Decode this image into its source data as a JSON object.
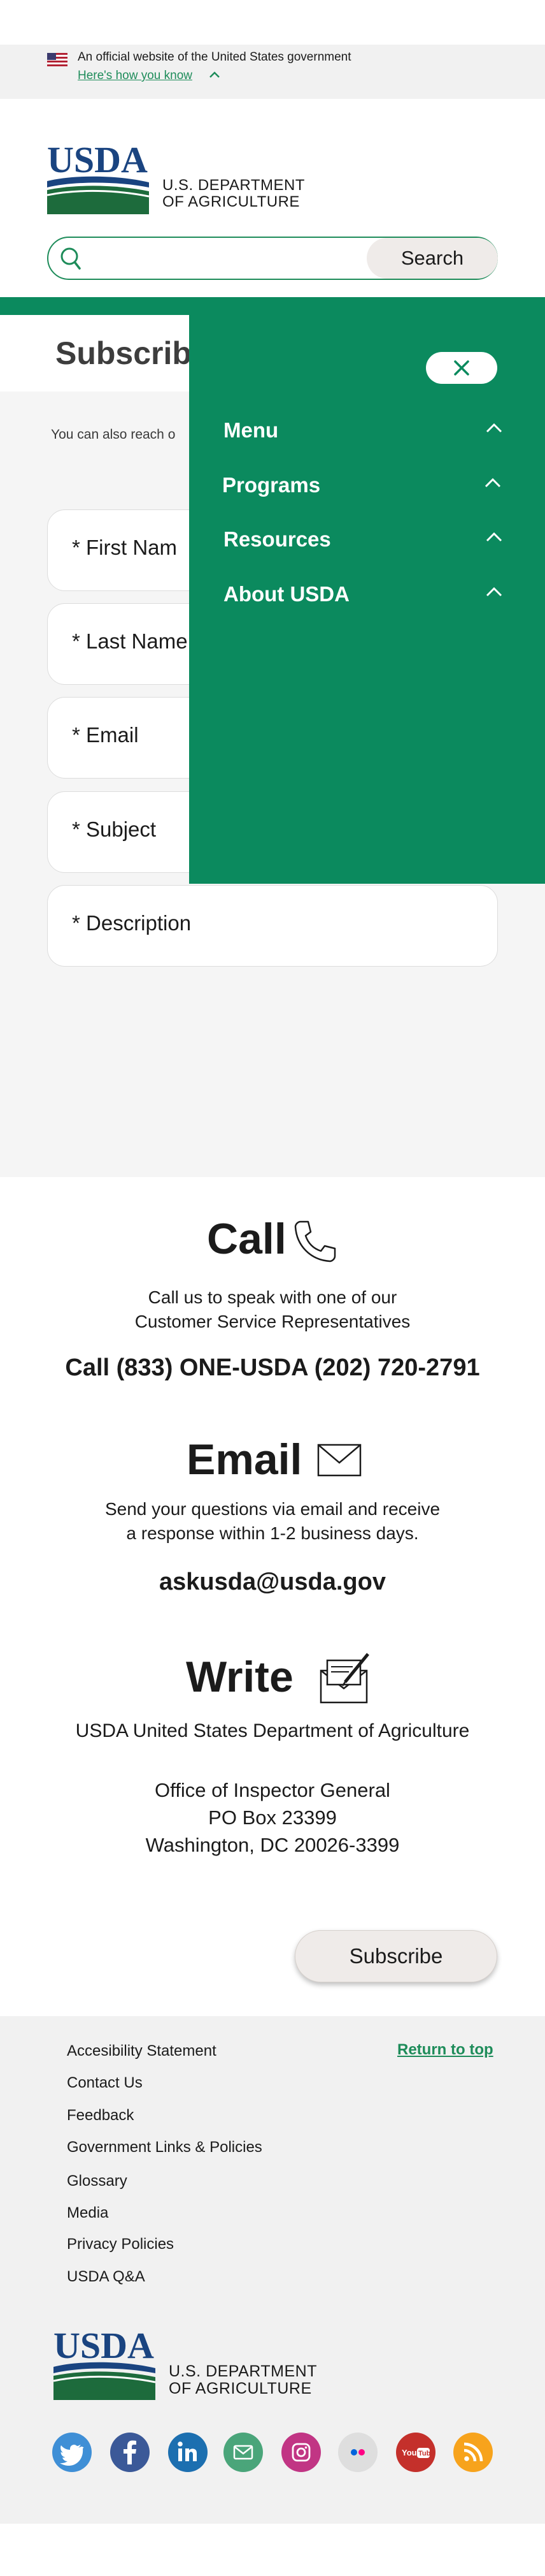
{
  "gov_banner": {
    "text": "An official website of the United States government",
    "link": "Here's how you know"
  },
  "header": {
    "logo_text": "USDA",
    "dept_line1": "U.S. DEPARTMENT",
    "dept_line2": "OF AGRICULTURE"
  },
  "search": {
    "placeholder": "",
    "button": "Search"
  },
  "nav": {
    "items": [
      {
        "label": "Menu"
      },
      {
        "label": "Programs"
      },
      {
        "label": "Resources"
      },
      {
        "label": "About USDA"
      }
    ]
  },
  "page": {
    "title": "Subscribe",
    "reach_text": "You can also reach o"
  },
  "form": {
    "fields": [
      {
        "label": "* First Nam"
      },
      {
        "label": "* Last Name"
      },
      {
        "label": "* Email"
      },
      {
        "label": "* Subject"
      },
      {
        "label": "* Description"
      }
    ]
  },
  "contact": {
    "call": {
      "title": "Call",
      "text_line1": "Call us to speak with one of our",
      "text_line2": "Customer Service Representatives",
      "number": "Call (833) ONE-USDA (202) 720-2791"
    },
    "email": {
      "title": "Email",
      "text_line1": "Send your questions via email and receive",
      "text_line2": "a response within 1-2 business days.",
      "address": "askusda@usda.gov"
    },
    "write": {
      "title": "Write",
      "org": "USDA United States Department of Agriculture",
      "addr_line1": "Office of Inspector General",
      "addr_line2": "PO Box 23399",
      "addr_line3": "Washington, DC 20026-3399"
    }
  },
  "subscribe_button": "Subscribe",
  "footer": {
    "links": [
      "Accesibility Statement",
      "Contact Us",
      "Feedback",
      "Government Links & Policies",
      "Glossary",
      "Media",
      "Privacy Policies",
      "USDA Q&A"
    ],
    "return_top": "Return to top",
    "logo_text": "USDA",
    "dept_line1": "U.S. DEPARTMENT",
    "dept_line2": "OF AGRICULTURE",
    "social": [
      {
        "name": "twitter-icon",
        "color": "#3f8fd6"
      },
      {
        "name": "facebook-icon",
        "color": "#3b5998"
      },
      {
        "name": "linkedin-icon",
        "color": "#1c6fb0"
      },
      {
        "name": "email-icon",
        "color": "#4aa57a"
      },
      {
        "name": "instagram-icon",
        "color": "#c13584"
      },
      {
        "name": "flickr-icon",
        "color": "#dedede"
      },
      {
        "name": "youtube-icon",
        "color": "#c4302b"
      },
      {
        "name": "rss-icon",
        "color": "#f7a31c"
      }
    ]
  },
  "colors": {
    "brand_green": "#0b8a5e",
    "link_green": "#1e8c5a",
    "usda_blue": "#1a4480"
  }
}
